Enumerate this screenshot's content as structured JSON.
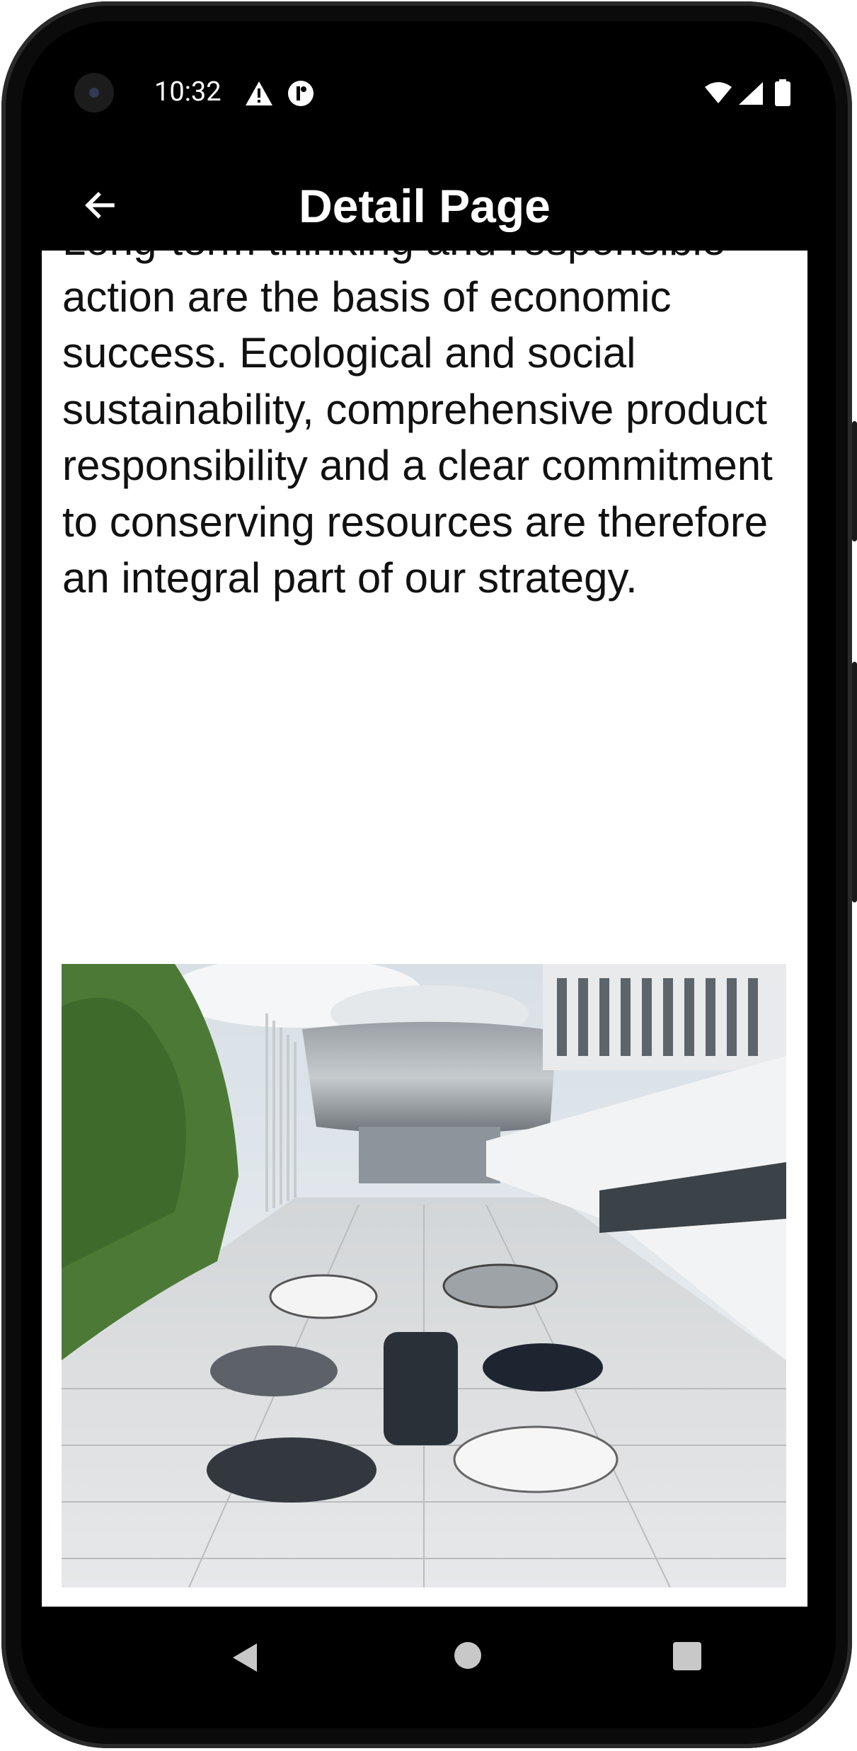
{
  "status_bar": {
    "time": "10:32",
    "icons": [
      "warning-icon",
      "cycle-icon",
      "wifi-icon",
      "signal-icon",
      "battery-icon"
    ]
  },
  "app_bar": {
    "title": "Detail Page",
    "back_icon": "arrow-left-icon",
    "background": "#000000",
    "text_color": "#ffffff"
  },
  "content": {
    "body_text": "Long-term thinking and responsible action are the basis of economic success. Ecological and social sustainability, comprehensive product responsibility and a clear commitment to conserving resources are therefore an integral part of our strategy.",
    "image": "photo of cars parked in a circle in front of a museum building"
  },
  "nav_bar": {
    "icons": [
      "nav-back-icon",
      "nav-home-icon",
      "nav-recents-icon"
    ]
  }
}
